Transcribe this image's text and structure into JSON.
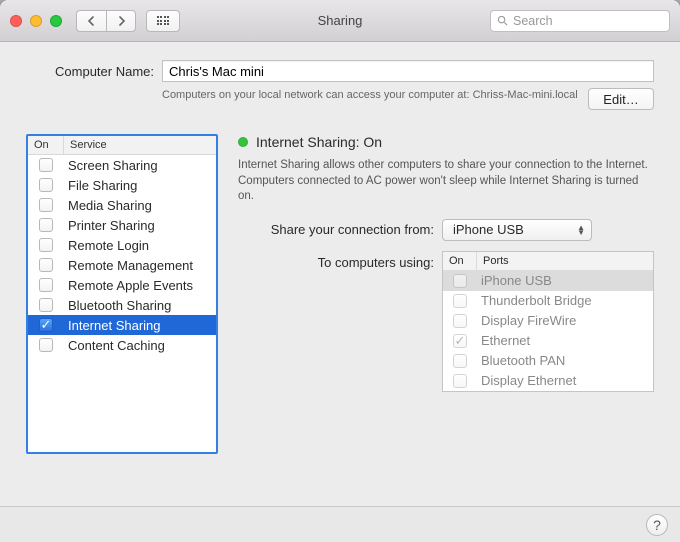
{
  "title": "Sharing",
  "search_placeholder": "Search",
  "computer_name_label": "Computer Name:",
  "computer_name": "Chris's Mac mini",
  "access_text": "Computers on your local network can access your computer at: Chriss-Mac-mini.local",
  "edit_label": "Edit…",
  "services": {
    "col_on": "On",
    "col_service": "Service",
    "items": [
      {
        "label": "Screen Sharing",
        "on": false,
        "selected": false
      },
      {
        "label": "File Sharing",
        "on": false,
        "selected": false
      },
      {
        "label": "Media Sharing",
        "on": false,
        "selected": false
      },
      {
        "label": "Printer Sharing",
        "on": false,
        "selected": false
      },
      {
        "label": "Remote Login",
        "on": false,
        "selected": false
      },
      {
        "label": "Remote Management",
        "on": false,
        "selected": false
      },
      {
        "label": "Remote Apple Events",
        "on": false,
        "selected": false
      },
      {
        "label": "Bluetooth Sharing",
        "on": false,
        "selected": false
      },
      {
        "label": "Internet Sharing",
        "on": true,
        "selected": true
      },
      {
        "label": "Content Caching",
        "on": false,
        "selected": false
      }
    ]
  },
  "detail": {
    "status_title": "Internet Sharing: On",
    "status_color": "#38c23a",
    "description": "Internet Sharing allows other computers to share your connection to the Internet. Computers connected to AC power won't sleep while Internet Sharing is turned on.",
    "share_from_label": "Share your connection from:",
    "share_from_value": "iPhone USB",
    "to_label": "To computers using:",
    "ports_col_on": "On",
    "ports_col_ports": "Ports",
    "ports": [
      {
        "label": "iPhone USB",
        "on": false,
        "selected": true
      },
      {
        "label": "Thunderbolt Bridge",
        "on": false,
        "selected": false
      },
      {
        "label": "Display FireWire",
        "on": false,
        "selected": false
      },
      {
        "label": "Ethernet",
        "on": true,
        "selected": false
      },
      {
        "label": "Bluetooth PAN",
        "on": false,
        "selected": false
      },
      {
        "label": "Display Ethernet",
        "on": false,
        "selected": false
      }
    ]
  },
  "help_label": "?"
}
